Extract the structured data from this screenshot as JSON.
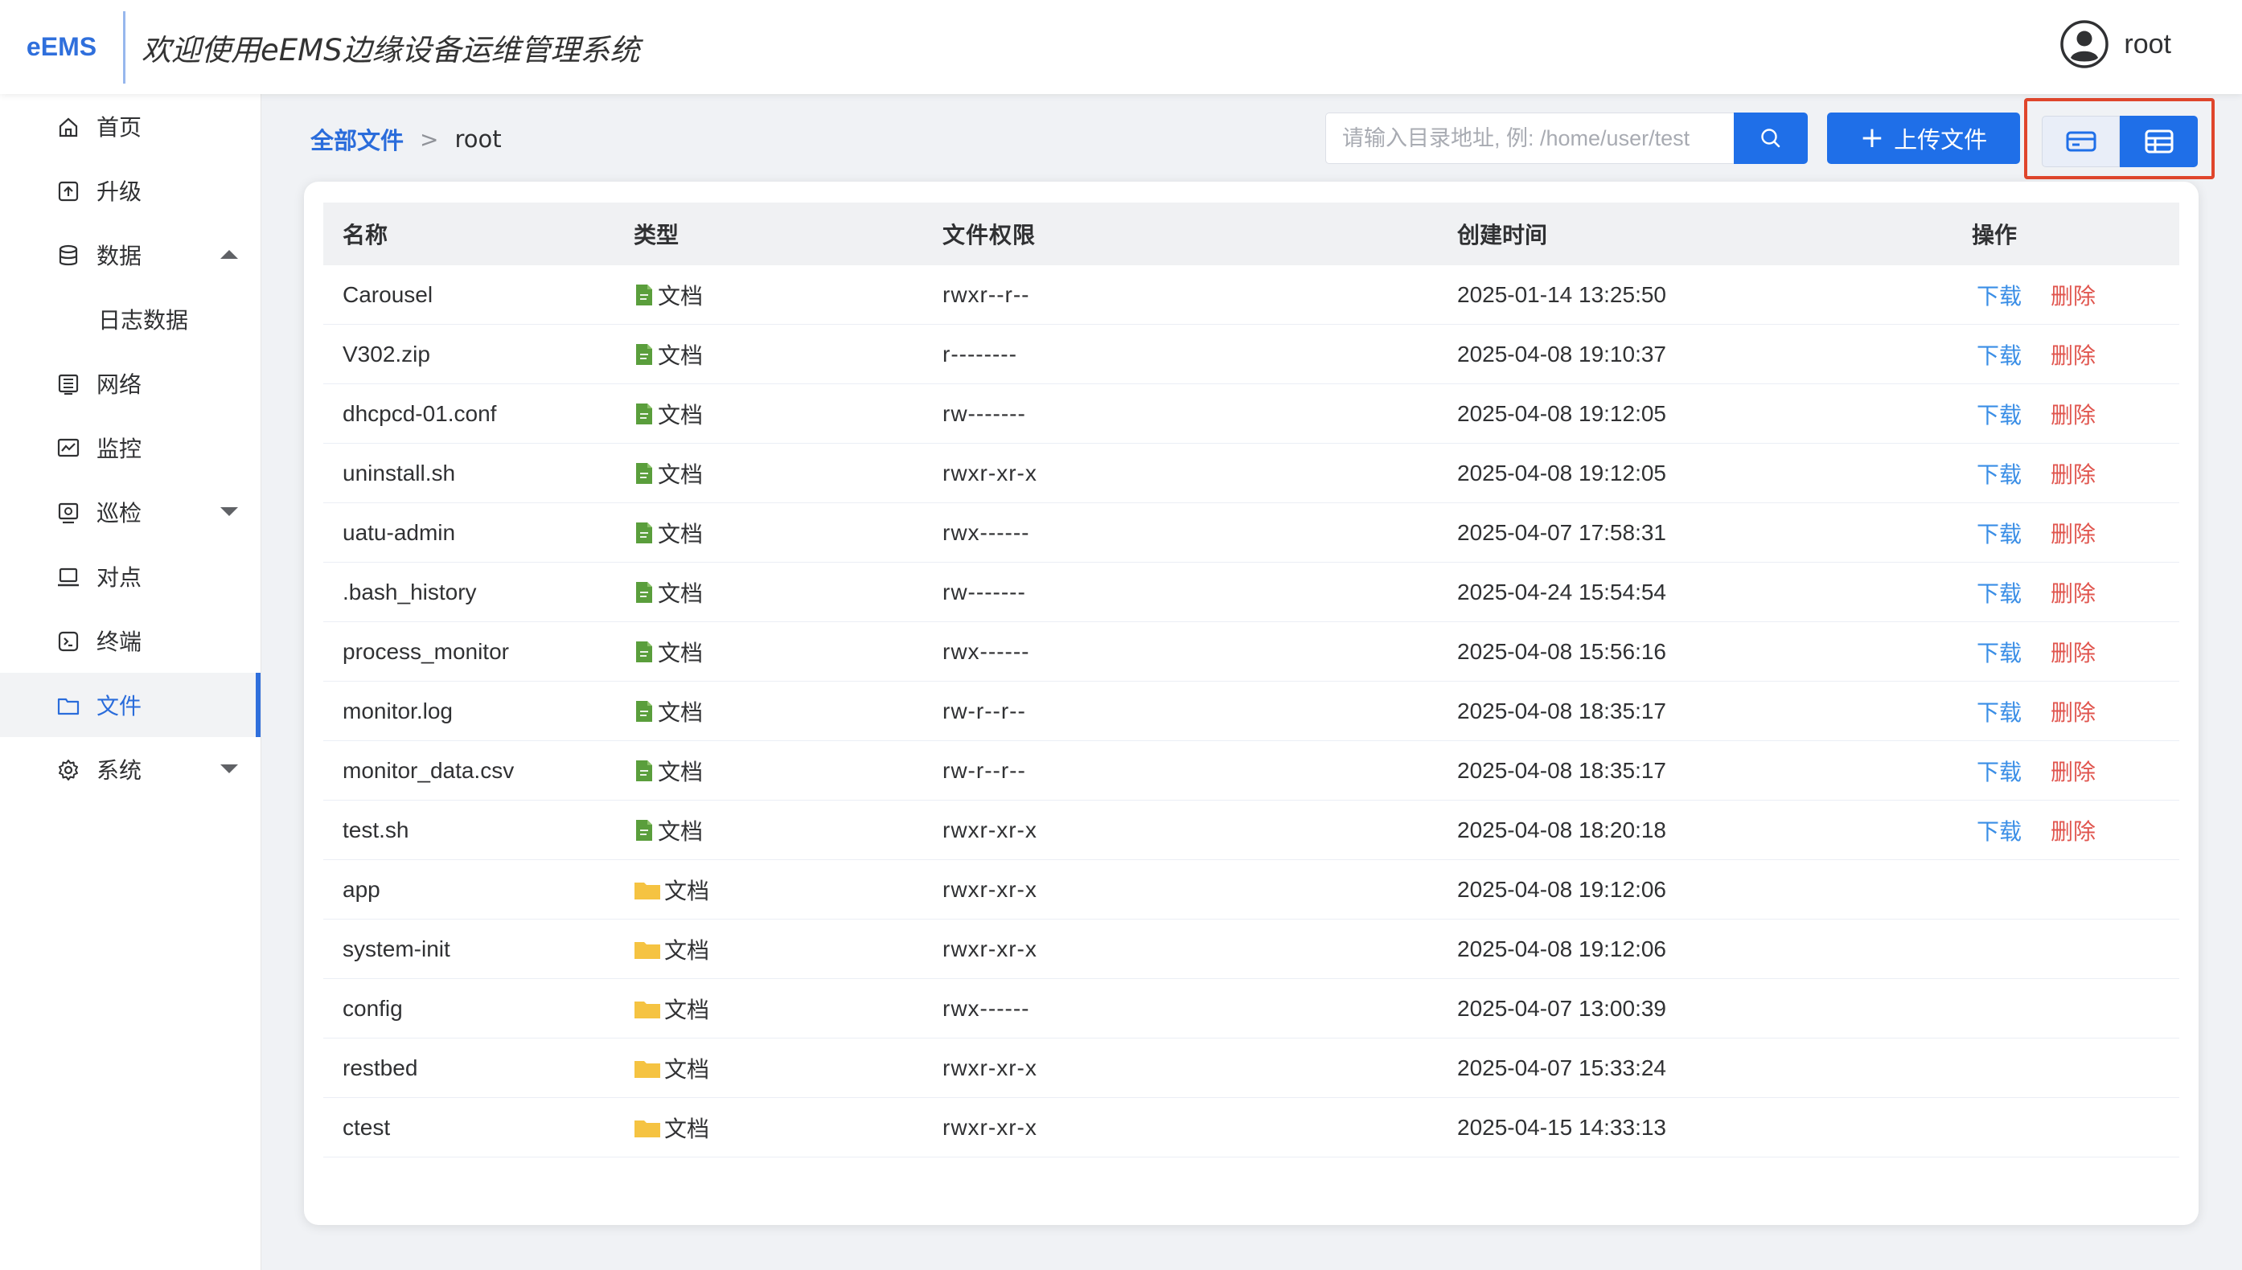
{
  "header": {
    "logo": "eEMS",
    "title": "欢迎使用eEMS边缘设备运维管理系统",
    "user_name": "root"
  },
  "sidebar": {
    "items": [
      {
        "label": "首页",
        "icon": "home-icon"
      },
      {
        "label": "升级",
        "icon": "upgrade-icon"
      },
      {
        "label": "数据",
        "icon": "database-icon",
        "expanded": true
      },
      {
        "label": "日志数据",
        "sub": true
      },
      {
        "label": "网络",
        "icon": "network-icon"
      },
      {
        "label": "监控",
        "icon": "monitor-chart-icon"
      },
      {
        "label": "巡检",
        "icon": "inspection-icon",
        "expanded": false
      },
      {
        "label": "对点",
        "icon": "laptop-icon"
      },
      {
        "label": "终端",
        "icon": "terminal-icon"
      },
      {
        "label": "文件",
        "icon": "folder-icon",
        "active": true
      },
      {
        "label": "系统",
        "icon": "gear-icon",
        "expanded": false
      }
    ]
  },
  "toolbar": {
    "breadcrumb_root": "全部文件",
    "breadcrumb_sep": ">",
    "breadcrumb_current": "root",
    "search_placeholder": "请输入目录地址, 例: /home/user/test",
    "upload_label": "上传文件",
    "upload_plus": "+"
  },
  "table": {
    "columns": [
      "名称",
      "类型",
      "文件权限",
      "创建时间",
      "操作"
    ],
    "actions": {
      "download": "下载",
      "delete": "删除"
    },
    "rows": [
      {
        "name": "Carousel",
        "kind": "file",
        "type": "文档",
        "perm": "rwxr--r--",
        "time": "2025-01-14 13:25:50"
      },
      {
        "name": "V302.zip",
        "kind": "file",
        "type": "文档",
        "perm": "r--------",
        "time": "2025-04-08 19:10:37"
      },
      {
        "name": "dhcpcd-01.conf",
        "kind": "file",
        "type": "文档",
        "perm": "rw-------",
        "time": "2025-04-08 19:12:05"
      },
      {
        "name": "uninstall.sh",
        "kind": "file",
        "type": "文档",
        "perm": "rwxr-xr-x",
        "time": "2025-04-08 19:12:05"
      },
      {
        "name": "uatu-admin",
        "kind": "file",
        "type": "文档",
        "perm": "rwx------",
        "time": "2025-04-07 17:58:31"
      },
      {
        "name": ".bash_history",
        "kind": "file",
        "type": "文档",
        "perm": "rw-------",
        "time": "2025-04-24 15:54:54"
      },
      {
        "name": "process_monitor",
        "kind": "file",
        "type": "文档",
        "perm": "rwx------",
        "time": "2025-04-08 15:56:16"
      },
      {
        "name": "monitor.log",
        "kind": "file",
        "type": "文档",
        "perm": "rw-r--r--",
        "time": "2025-04-08 18:35:17"
      },
      {
        "name": "monitor_data.csv",
        "kind": "file",
        "type": "文档",
        "perm": "rw-r--r--",
        "time": "2025-04-08 18:35:17"
      },
      {
        "name": "test.sh",
        "kind": "file",
        "type": "文档",
        "perm": "rwxr-xr-x",
        "time": "2025-04-08 18:20:18"
      },
      {
        "name": "app",
        "kind": "folder",
        "type": "文档",
        "perm": "rwxr-xr-x",
        "time": "2025-04-08 19:12:06"
      },
      {
        "name": "system-init",
        "kind": "folder",
        "type": "文档",
        "perm": "rwxr-xr-x",
        "time": "2025-04-08 19:12:06"
      },
      {
        "name": "config",
        "kind": "folder",
        "type": "文档",
        "perm": "rwx------",
        "time": "2025-04-07 13:00:39"
      },
      {
        "name": "restbed",
        "kind": "folder",
        "type": "文档",
        "perm": "rwxr-xr-x",
        "time": "2025-04-07 15:33:24"
      },
      {
        "name": "ctest",
        "kind": "folder",
        "type": "文档",
        "perm": "rwxr-xr-x",
        "time": "2025-04-15 14:33:13"
      }
    ]
  },
  "colors": {
    "primary": "#1f6fe8",
    "brand_text": "#2f6fdc",
    "danger": "#e0564f",
    "highlight_box": "#e0462c",
    "file_icon": "#5a9e3c",
    "folder_icon": "#f5c342"
  }
}
